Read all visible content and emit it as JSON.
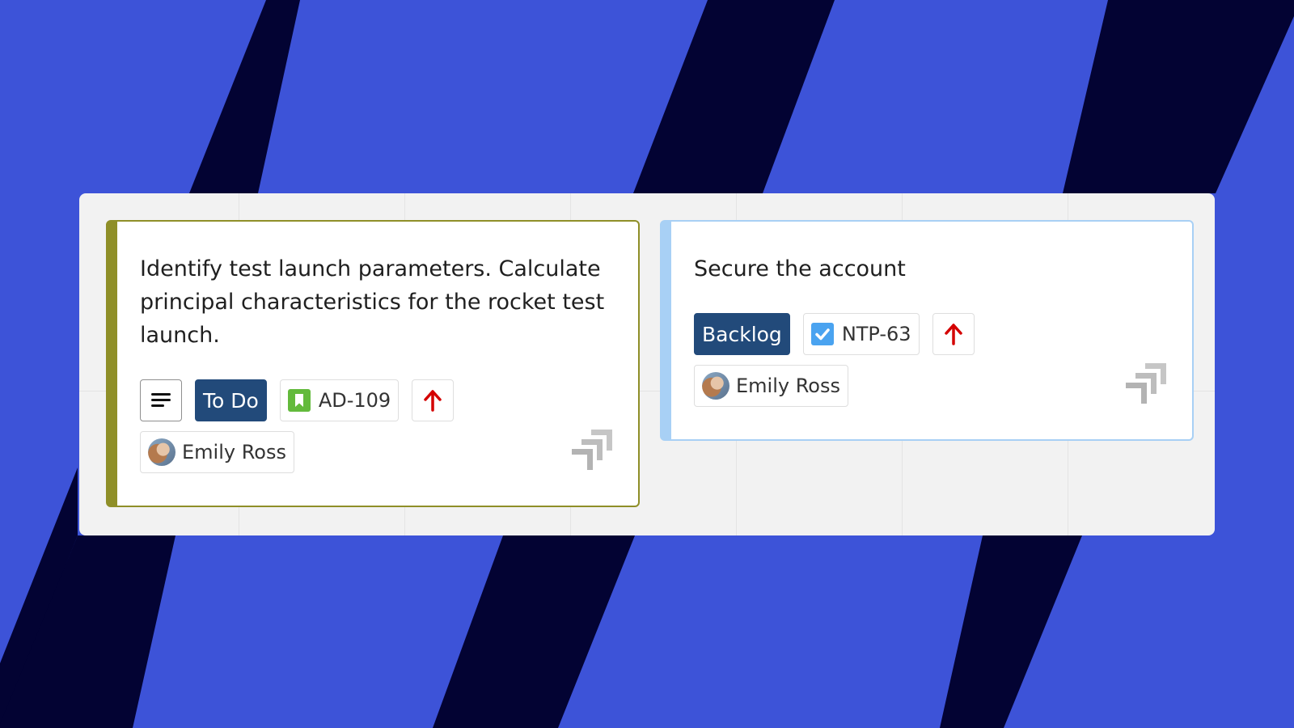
{
  "cards": [
    {
      "title": "Identify test launch parameters. Calculate principal characteristics for the rocket test launch.",
      "status": "To Do",
      "issue_key": "AD-109",
      "issue_type_icon": "bookmark-icon",
      "priority_icon": "arrow-up-icon",
      "assignee": "Emily Ross",
      "accent_color": "#8f8f28",
      "status_color": "#224a7a"
    },
    {
      "title": "Secure the account",
      "status": "Backlog",
      "issue_key": "NTP-63",
      "issue_type_icon": "checkbox-icon",
      "priority_icon": "arrow-up-icon",
      "assignee": "Emily Ross",
      "accent_color": "#a8d0f5",
      "status_color": "#224a7a"
    }
  ],
  "colors": {
    "background": "#3d53d8",
    "stripe": "#030333",
    "priority": "#d40000",
    "story_icon": "#63ba3c",
    "task_icon": "#4aa3f0"
  }
}
